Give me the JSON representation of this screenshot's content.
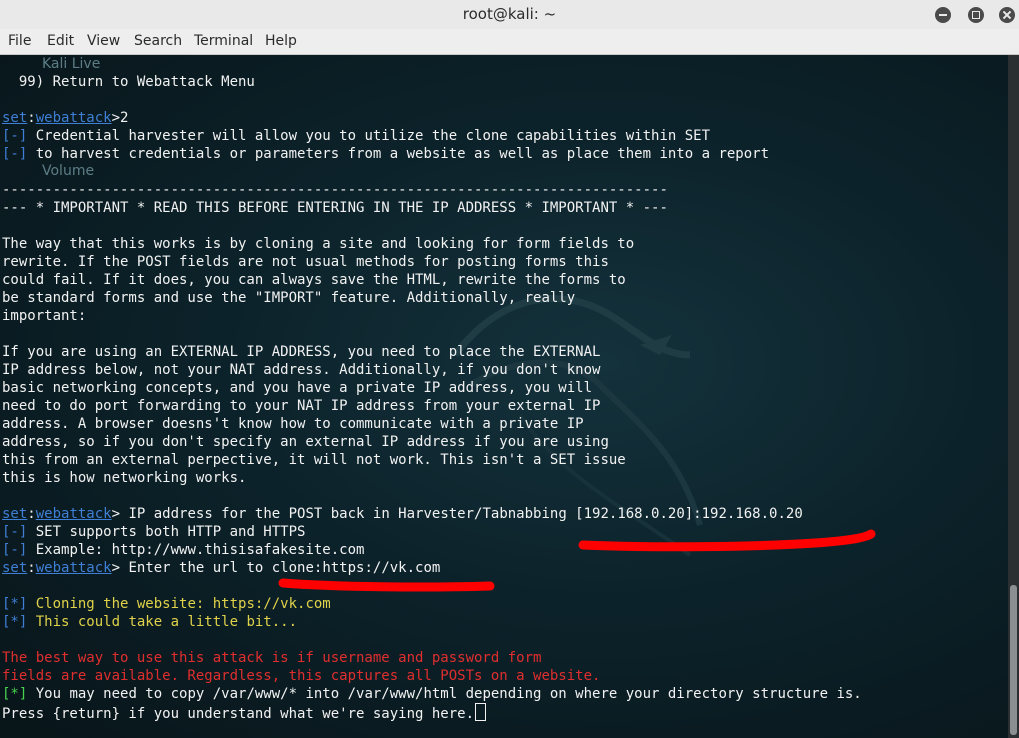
{
  "window": {
    "title": "root@kali: ~"
  },
  "menu": [
    "File",
    "Edit",
    "View",
    "Search",
    "Terminal",
    "Help"
  ],
  "desktop": {
    "item1": "Kali Live",
    "item2": "Volume"
  },
  "terminal": {
    "l1": "  99) Return to Webattack Menu",
    "prompt_set": "set",
    "prompt_colon": ":",
    "prompt_module": "webattack",
    "prompt_gt": ">",
    "l2_input": "2",
    "bracket_minus": "[-]",
    "l3": " Credential harvester will allow you to utilize the clone capabilities within SET",
    "l4": " to harvest credentials or parameters from a website as well as place them into a report",
    "sep": "-------------------------------------------------------------------------------",
    "important": "--- * IMPORTANT * READ THIS BEFORE ENTERING IN THE IP ADDRESS * IMPORTANT * ---",
    "para1": [
      "The way that this works is by cloning a site and looking for form fields to",
      "rewrite. If the POST fields are not usual methods for posting forms this",
      "could fail. If it does, you can always save the HTML, rewrite the forms to",
      "be standard forms and use the \"IMPORT\" feature. Additionally, really",
      "important:"
    ],
    "para2": [
      "If you are using an EXTERNAL IP ADDRESS, you need to place the EXTERNAL",
      "IP address below, not your NAT address. Additionally, if you don't know",
      "basic networking concepts, and you have a private IP address, you will",
      "need to do port forwarding to your NAT IP address from your external IP",
      "address. A browser doesns't know how to communicate with a private IP",
      "address, so if you don't specify an external IP address if you are using",
      "this from an external perpective, it will not work. This isn't a SET issue",
      "this is how networking works."
    ],
    "ip_prompt": " IP address for the POST back in Harvester/Tabnabbing [192.168.0.20]:192.168.0.20",
    "l_https": " SET supports both HTTP and HTTPS",
    "l_example": " Example: http://www.thisisafakesite.com",
    "url_prompt": " Enter the url to clone:https://vk.com",
    "bracket_star": "[*]",
    "cloning": " Cloning the website: https://vk.com",
    "take_bit": " This could take a little bit...",
    "red1": "The best way to use this attack is if username and password form",
    "red2": "fields are available. Regardless, this captures all POSTs on a website.",
    "copy": " You may need to copy /var/www/* into /var/www/html depending on where your directory structure is.",
    "press": "Press {return} if you understand what we're saying here."
  },
  "colors": {
    "annotation": "#ff0000",
    "prompt": "#3f7fd6",
    "info": "#e0d24a",
    "warning": "#e02e2e",
    "success": "#48d34f"
  },
  "icons": {
    "minimize": "minimize-icon",
    "maximize": "maximize-icon",
    "close": "close-icon"
  }
}
